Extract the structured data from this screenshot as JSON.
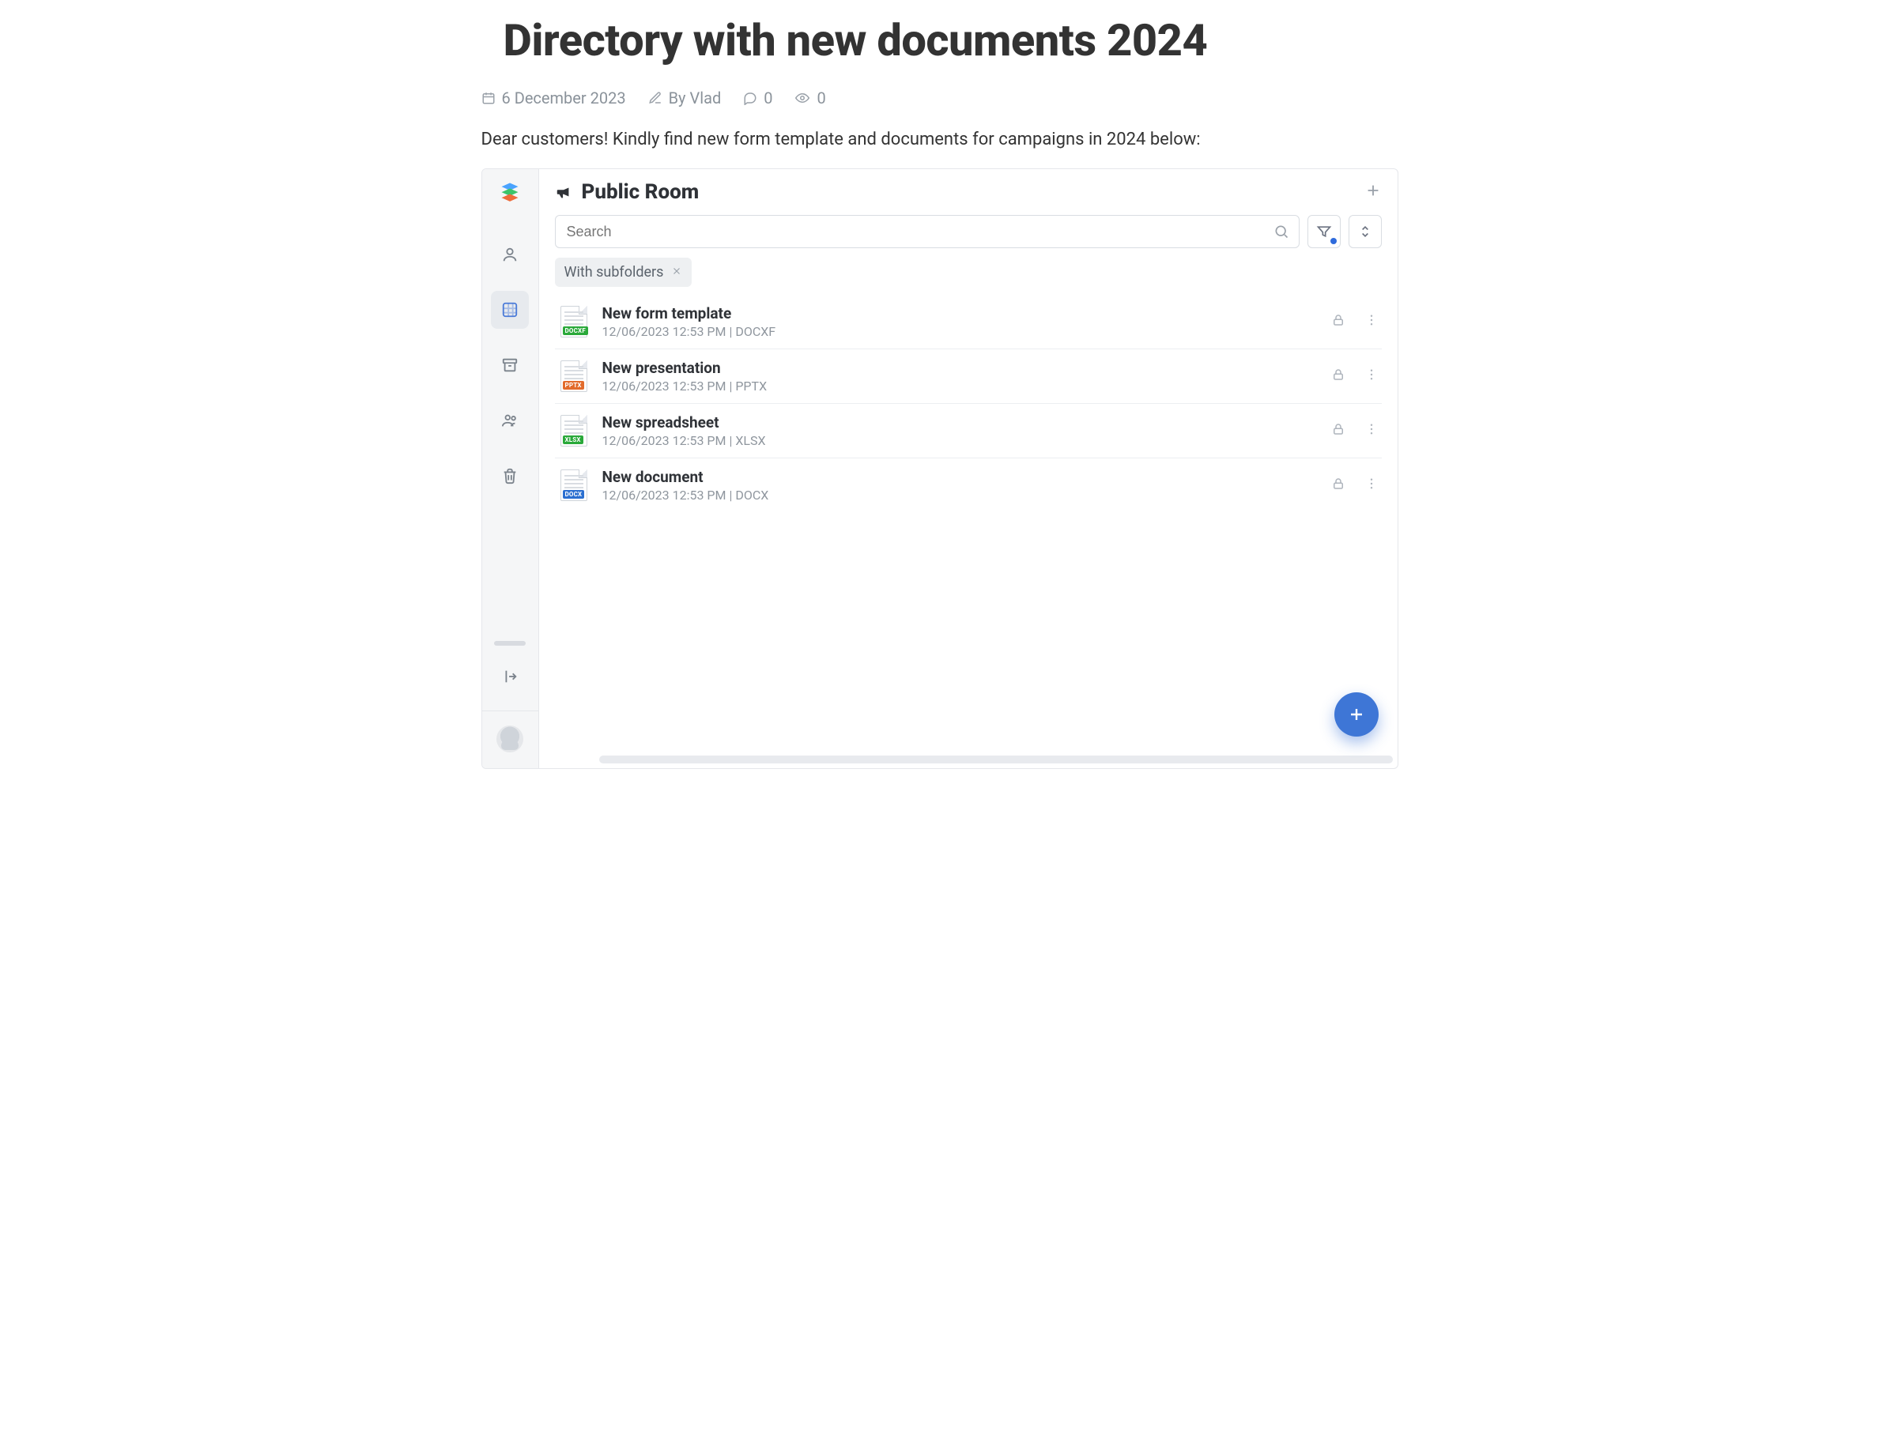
{
  "page": {
    "title": "Directory with new documents 2024",
    "date": "6 December 2023",
    "author": "By Vlad",
    "comments": "0",
    "views": "0",
    "intro": "Dear customers! Kindly find new form template and documents for campaigns in 2024 below:"
  },
  "app": {
    "header": {
      "title": "Public Room"
    },
    "search": {
      "placeholder": "Search"
    },
    "filter_chip": {
      "label": "With subfolders"
    },
    "sidebar": {
      "items": [
        "logo",
        "person",
        "grid",
        "archive",
        "group",
        "trash"
      ],
      "active": "grid"
    },
    "files": [
      {
        "name": "New form template",
        "meta": "12/06/2023 12:53 PM | DOCXF",
        "tag": "DOCXF",
        "tag_class": "docxf"
      },
      {
        "name": "New presentation",
        "meta": "12/06/2023 12:53 PM | PPTX",
        "tag": "PPTX",
        "tag_class": "pptx"
      },
      {
        "name": "New spreadsheet",
        "meta": "12/06/2023 12:53 PM | XLSX",
        "tag": "XLSX",
        "tag_class": "xlsx"
      },
      {
        "name": "New document",
        "meta": "12/06/2023 12:53 PM | DOCX",
        "tag": "DOCX",
        "tag_class": "docx"
      }
    ]
  }
}
